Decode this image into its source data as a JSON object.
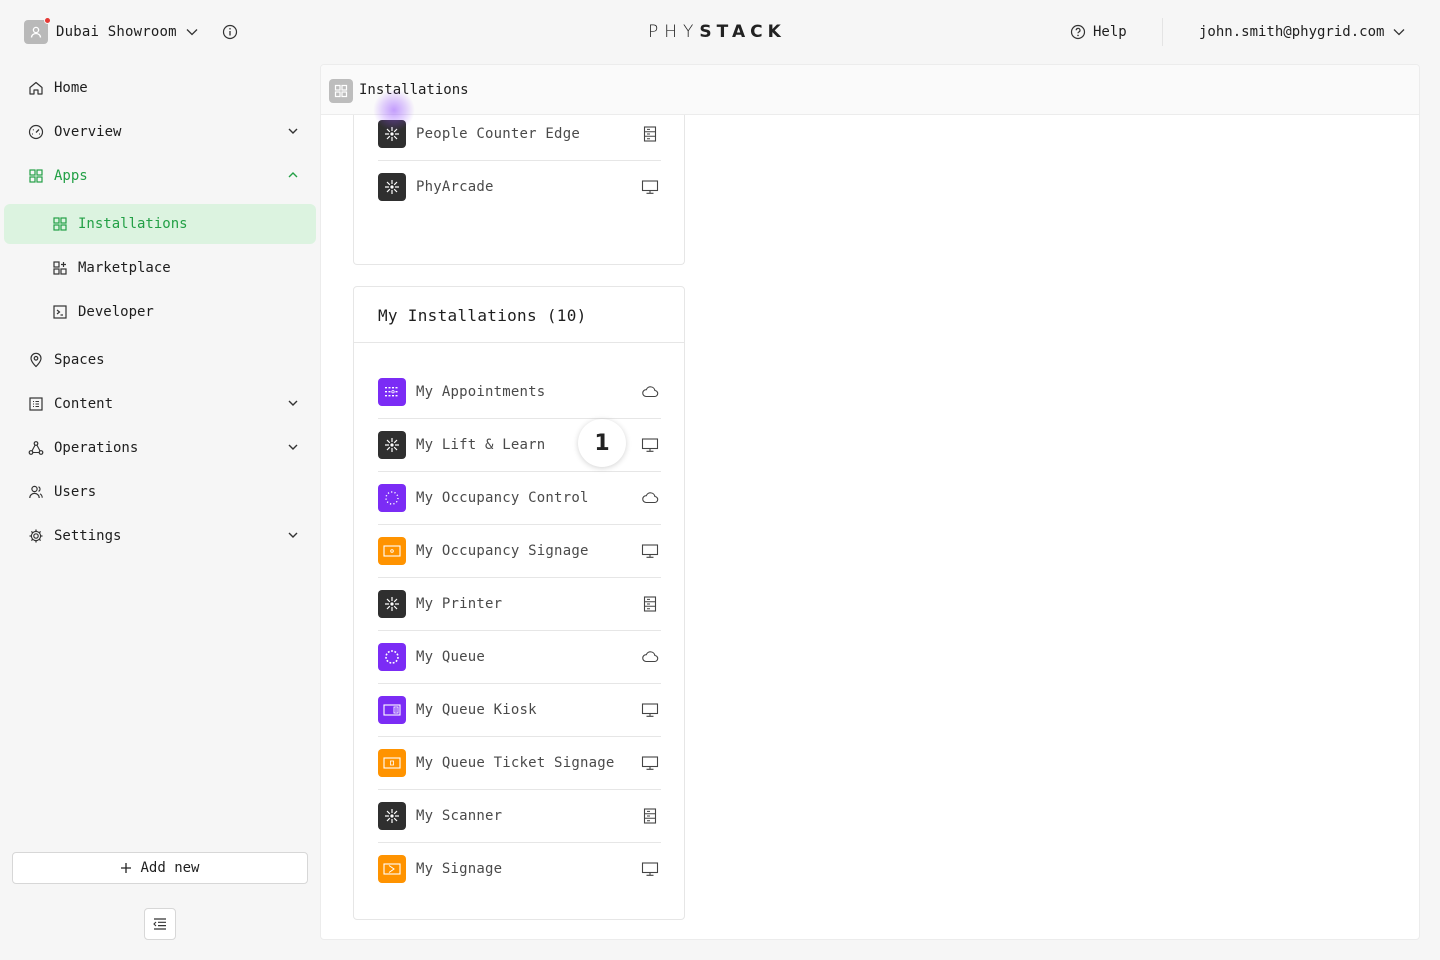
{
  "topbar": {
    "workspace_name": "Dubai Showroom",
    "brand_light": "PHY",
    "brand_bold": "STACK",
    "help_label": "Help",
    "user_email": "john.smith@phygrid.com"
  },
  "sidebar": {
    "items": [
      {
        "label": "Home",
        "icon": "home-icon"
      },
      {
        "label": "Overview",
        "icon": "gauge-icon",
        "expandable": true
      },
      {
        "label": "Apps",
        "icon": "grid-icon",
        "expanded": true
      },
      {
        "label": "Installations",
        "icon": "grid-icon",
        "active": true
      },
      {
        "label": "Marketplace",
        "icon": "apps-plus-icon"
      },
      {
        "label": "Developer",
        "icon": "terminal-icon"
      },
      {
        "label": "Spaces",
        "icon": "map-pin-icon"
      },
      {
        "label": "Content",
        "icon": "list-icon",
        "expandable": true
      },
      {
        "label": "Operations",
        "icon": "network-icon",
        "expandable": true
      },
      {
        "label": "Users",
        "icon": "users-icon"
      },
      {
        "label": "Settings",
        "icon": "gear-icon",
        "expandable": true
      }
    ],
    "add_new_label": "Add new"
  },
  "main": {
    "title": "Installations",
    "top_card": {
      "items": [
        {
          "name": "People Counter Edge",
          "icon_style": "dark",
          "type_icon": "server-icon"
        },
        {
          "name": "PhyArcade",
          "icon_style": "dark",
          "type_icon": "monitor-icon"
        }
      ]
    },
    "my_installations": {
      "title": "My Installations (10)",
      "items": [
        {
          "name": "My Appointments",
          "icon_style": "purple",
          "type_icon": "cloud-icon"
        },
        {
          "name": "My Lift & Learn",
          "icon_style": "dark",
          "type_icon": "monitor-icon"
        },
        {
          "name": "My Occupancy Control",
          "icon_style": "purple",
          "type_icon": "cloud-icon"
        },
        {
          "name": "My Occupancy Signage",
          "icon_style": "orange",
          "type_icon": "monitor-icon"
        },
        {
          "name": "My Printer",
          "icon_style": "dark",
          "type_icon": "server-icon"
        },
        {
          "name": "My Queue",
          "icon_style": "purple",
          "type_icon": "cloud-icon"
        },
        {
          "name": "My Queue Kiosk",
          "icon_style": "purple",
          "type_icon": "monitor-icon"
        },
        {
          "name": "My Queue Ticket Signage",
          "icon_style": "orange",
          "type_icon": "monitor-icon"
        },
        {
          "name": "My Scanner",
          "icon_style": "dark",
          "type_icon": "server-icon"
        },
        {
          "name": "My Signage",
          "icon_style": "orange",
          "type_icon": "monitor-icon"
        }
      ]
    },
    "badge": "1"
  },
  "colors": {
    "accent_green": "#23a046",
    "active_bg": "#dcf3e0",
    "app_dark": "#2f2f2f",
    "app_purple": "#7b2cf5",
    "app_orange": "#ff9300"
  }
}
